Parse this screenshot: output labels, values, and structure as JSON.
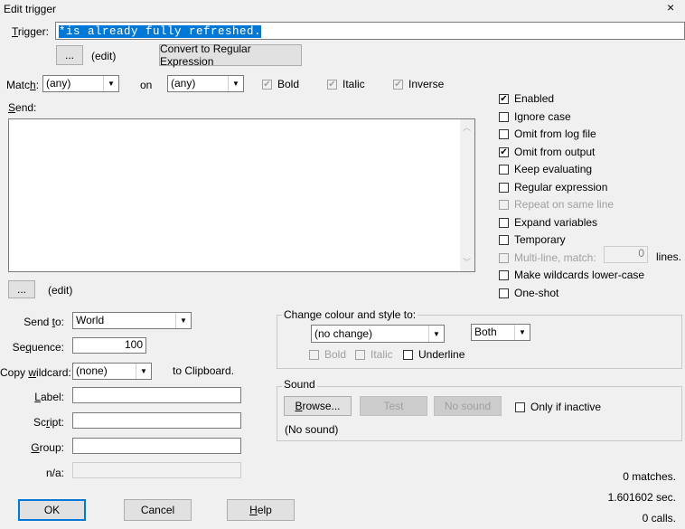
{
  "window": {
    "title": "Edit trigger",
    "close_glyph": "×"
  },
  "trigger": {
    "label": "Trigger:",
    "value": "*is already fully refreshed."
  },
  "trigger_edit": {
    "dots_label": "...",
    "edit_label": "(edit)"
  },
  "convert_button": "Convert to Regular Expression",
  "match": {
    "label": "Match:",
    "fg_value": "(any)",
    "on_label": "on",
    "bg_value": "(any)",
    "bold_label": "Bold",
    "italic_label": "Italic",
    "inverse_label": "Inverse"
  },
  "send": {
    "label": "Send:",
    "dots_label": "...",
    "edit_label": "(edit)"
  },
  "options": [
    {
      "label": "Enabled",
      "checked": true,
      "disabled": false
    },
    {
      "label": "Ignore case",
      "checked": false,
      "disabled": false
    },
    {
      "label": "Omit from log file",
      "checked": false,
      "disabled": false
    },
    {
      "label": "Omit from output",
      "checked": true,
      "disabled": false
    },
    {
      "label": "Keep evaluating",
      "checked": false,
      "disabled": false
    },
    {
      "label": "Regular expression",
      "checked": false,
      "disabled": false
    },
    {
      "label": "Repeat on same line",
      "checked": false,
      "disabled": true
    },
    {
      "label": "Expand variables",
      "checked": false,
      "disabled": false
    },
    {
      "label": "Temporary",
      "checked": false,
      "disabled": false
    },
    {
      "label": "Multi-line, match:",
      "checked": false,
      "disabled": true
    },
    {
      "label": "Make wildcards lower-case",
      "checked": false,
      "disabled": false
    },
    {
      "label": "One-shot",
      "checked": false,
      "disabled": false
    }
  ],
  "multiline": {
    "value": "0",
    "suffix": "lines."
  },
  "send_to": {
    "label": "Send to:",
    "value": "World"
  },
  "sequence": {
    "label": "Sequence:",
    "value": "100"
  },
  "copy_wildcard": {
    "label": "Copy wildcard:",
    "value": "(none)",
    "suffix": "to Clipboard."
  },
  "label_field": {
    "label": "Label:",
    "value": ""
  },
  "script_field": {
    "label": "Script:",
    "value": ""
  },
  "group_field": {
    "label": "Group:",
    "value": ""
  },
  "na_field": {
    "label": "n/a:",
    "value": ""
  },
  "colour_group": {
    "title": "Change colour and style to:",
    "colour_value": "(no change)",
    "style_value": "Both",
    "bold_label": "Bold",
    "italic_label": "Italic",
    "underline_label": "Underline"
  },
  "sound_group": {
    "title": "Sound",
    "browse_label": "Browse...",
    "test_label": "Test",
    "nosound_label": "No sound",
    "only_inactive_label": "Only if inactive",
    "status": "(No sound)"
  },
  "stats": {
    "matches": "0 matches.",
    "time": "1.601602 sec.",
    "calls": "0 calls."
  },
  "buttons": {
    "ok": "OK",
    "cancel": "Cancel",
    "help": "Help"
  },
  "colors": {
    "selection": "#0078d7",
    "accent": "#0078d7"
  }
}
